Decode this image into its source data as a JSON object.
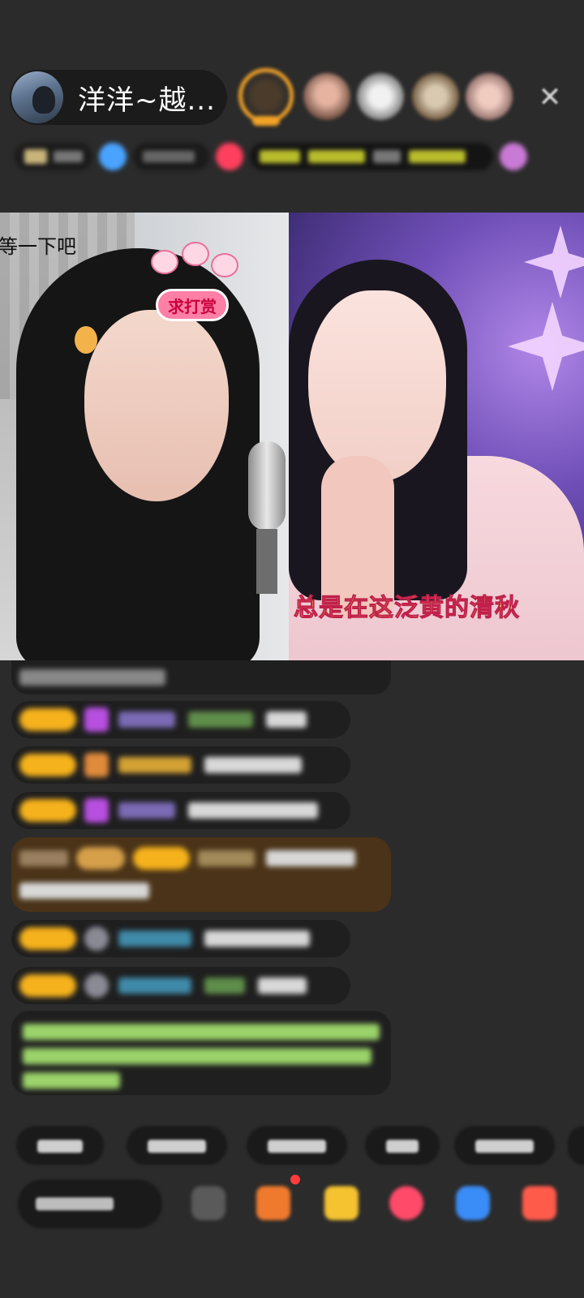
{
  "header": {
    "host_name": "洋洋~越...",
    "viewers": [
      "viewer-1",
      "viewer-2",
      "viewer-3",
      "viewer-4",
      "viewer-5"
    ],
    "close_icon": "close-icon"
  },
  "video": {
    "left_caption": "等一下吧",
    "sticker_text": "求打赏",
    "lyric": "总是在这泛黄的清秋"
  },
  "colors": {
    "background": "#2b2b2b",
    "level_badge": "#f6b21c",
    "lyric_fill": "#f6d64a",
    "lyric_stroke": "#c0204a",
    "host_ring": "#f2a227"
  }
}
